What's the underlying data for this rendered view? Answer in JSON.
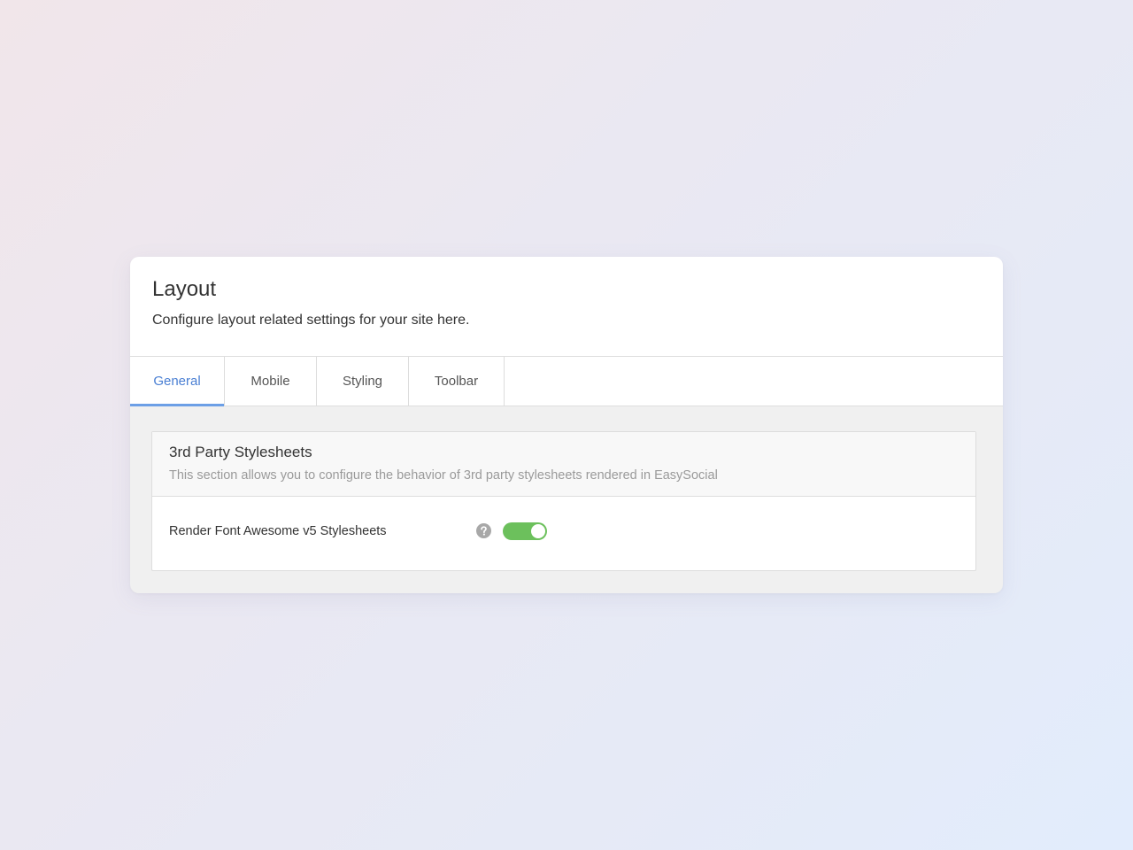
{
  "header": {
    "title": "Layout",
    "description": "Configure layout related settings for your site here."
  },
  "tabs": [
    {
      "label": "General",
      "active": true
    },
    {
      "label": "Mobile",
      "active": false
    },
    {
      "label": "Styling",
      "active": false
    },
    {
      "label": "Toolbar",
      "active": false
    }
  ],
  "section": {
    "title": "3rd Party Stylesheets",
    "description": "This section allows you to configure the behavior of 3rd party stylesheets rendered in EasySocial",
    "settings": [
      {
        "label": "Render Font Awesome v5 Stylesheets",
        "help_icon": "question-circle-icon",
        "enabled": true
      }
    ]
  },
  "colors": {
    "accent": "#4a7fd3",
    "toggle_on": "#6cc05c"
  }
}
